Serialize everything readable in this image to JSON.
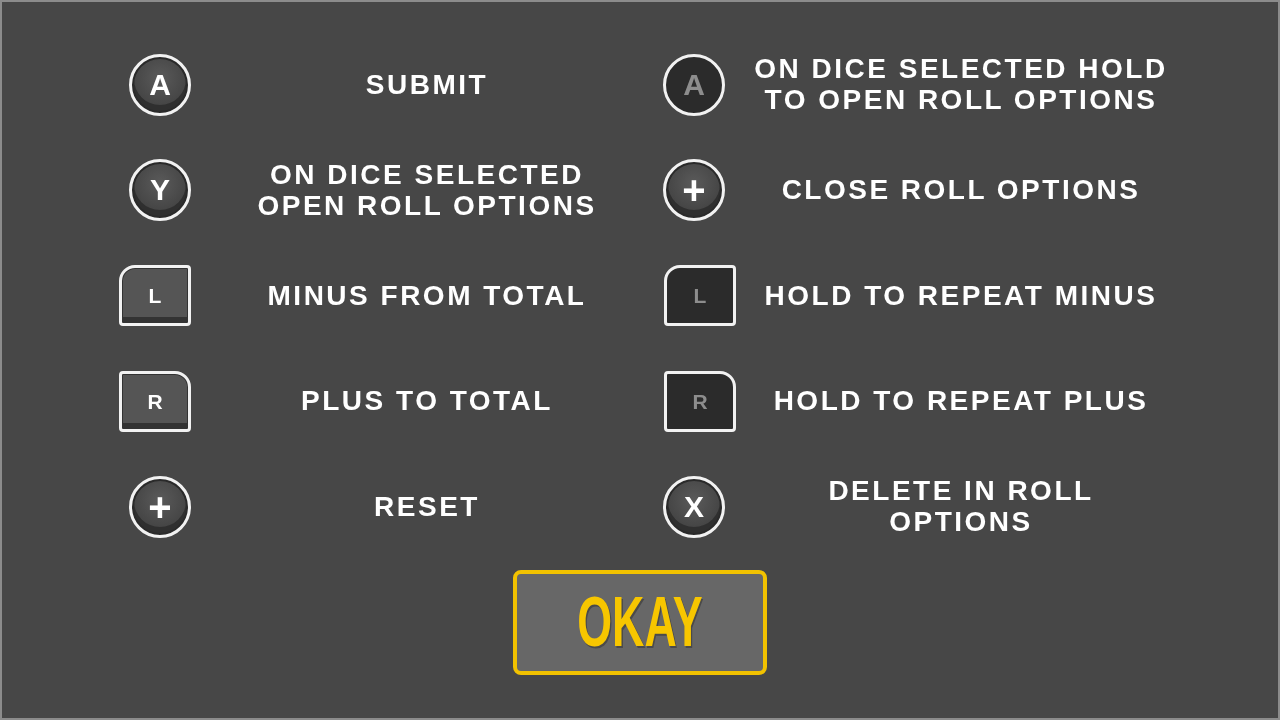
{
  "columns": [
    {
      "rows": [
        {
          "button": {
            "kind": "round",
            "glyph": "A",
            "dimmed": false
          },
          "action": "SUBMIT"
        },
        {
          "button": {
            "kind": "round",
            "glyph": "Y",
            "dimmed": false
          },
          "action": "ON DICE SELECTED\nOPEN ROLL OPTIONS"
        },
        {
          "button": {
            "kind": "shoulder_left",
            "glyph": "L",
            "dimmed": false
          },
          "action": "MINUS FROM TOTAL"
        },
        {
          "button": {
            "kind": "shoulder_right",
            "glyph": "R",
            "dimmed": false
          },
          "action": "PLUS TO TOTAL"
        },
        {
          "button": {
            "kind": "round",
            "glyph": "+",
            "dimmed": false
          },
          "action": "RESET"
        }
      ]
    },
    {
      "rows": [
        {
          "button": {
            "kind": "round",
            "glyph": "A",
            "dimmed": true
          },
          "action": "ON DICE SELECTED HOLD\nTO OPEN ROLL OPTIONS"
        },
        {
          "button": {
            "kind": "round",
            "glyph": "+",
            "dimmed": false
          },
          "action": "CLOSE ROLL OPTIONS"
        },
        {
          "button": {
            "kind": "shoulder_left",
            "glyph": "L",
            "dimmed": true
          },
          "action": "HOLD TO REPEAT MINUS"
        },
        {
          "button": {
            "kind": "shoulder_right",
            "glyph": "R",
            "dimmed": true
          },
          "action": "HOLD TO REPEAT PLUS"
        },
        {
          "button": {
            "kind": "round",
            "glyph": "X",
            "dimmed": false
          },
          "action": "DELETE IN ROLL\nOPTIONS"
        }
      ]
    }
  ],
  "okay_button": {
    "label": "OKAY"
  }
}
